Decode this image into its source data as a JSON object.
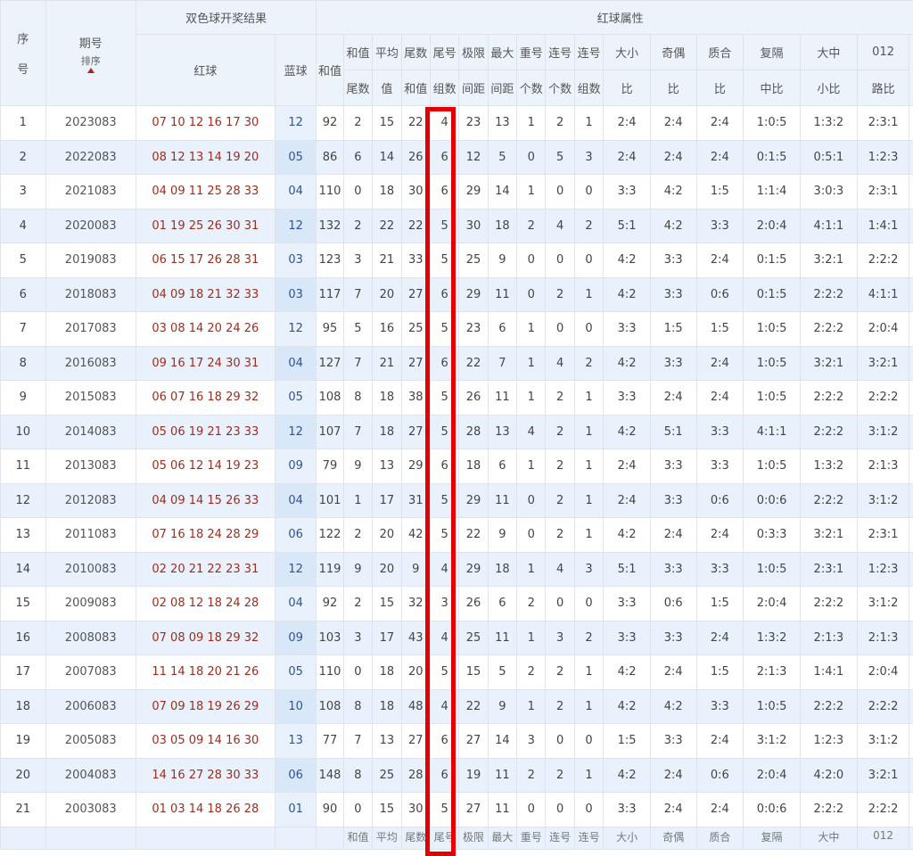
{
  "header": {
    "seq_top": "序",
    "seq_bottom": "号",
    "period": "期号",
    "sort_label": "排序",
    "draw_result": "双色球开奖结果",
    "red_attrs": "红球属性",
    "red_ball": "红球",
    "blue_ball": "蓝球",
    "sum": "和值",
    "cols": [
      {
        "top": "和值",
        "bottom": "尾数"
      },
      {
        "top": "平均",
        "bottom": "值"
      },
      {
        "top": "尾数",
        "bottom": "和值"
      },
      {
        "top": "尾号",
        "bottom": "组数"
      },
      {
        "top": "极限",
        "bottom": "间距"
      },
      {
        "top": "最大",
        "bottom": "间距"
      },
      {
        "top": "重号",
        "bottom": "个数"
      },
      {
        "top": "连号",
        "bottom": "个数"
      },
      {
        "top": "连号",
        "bottom": "组数"
      },
      {
        "top": "大小",
        "bottom": "比"
      },
      {
        "top": "奇偶",
        "bottom": "比"
      },
      {
        "top": "质合",
        "bottom": "比"
      },
      {
        "top": "复隔",
        "bottom": "中比"
      },
      {
        "top": "大中",
        "bottom": "小比"
      },
      {
        "top": "012",
        "bottom": "路比"
      }
    ]
  },
  "rows": [
    {
      "seq": "1",
      "period": "2023083",
      "red": "07 10 12 16 17 30",
      "blue": "12",
      "sum": "92",
      "vals": [
        "2",
        "15",
        "22",
        "4",
        "23",
        "13",
        "1",
        "2",
        "1",
        "2:4",
        "2:4",
        "2:4",
        "1:0:5",
        "1:3:2",
        "2:3:1"
      ]
    },
    {
      "seq": "2",
      "period": "2022083",
      "red": "08 12 13 14 19 20",
      "blue": "05",
      "sum": "86",
      "vals": [
        "6",
        "14",
        "26",
        "6",
        "12",
        "5",
        "0",
        "5",
        "3",
        "2:4",
        "2:4",
        "2:4",
        "0:1:5",
        "0:5:1",
        "1:2:3"
      ]
    },
    {
      "seq": "3",
      "period": "2021083",
      "red": "04 09 11 25 28 33",
      "blue": "04",
      "sum": "110",
      "vals": [
        "0",
        "18",
        "30",
        "6",
        "29",
        "14",
        "1",
        "0",
        "0",
        "3:3",
        "4:2",
        "1:5",
        "1:1:4",
        "3:0:3",
        "2:3:1"
      ]
    },
    {
      "seq": "4",
      "period": "2020083",
      "red": "01 19 25 26 30 31",
      "blue": "12",
      "sum": "132",
      "vals": [
        "2",
        "22",
        "22",
        "5",
        "30",
        "18",
        "2",
        "4",
        "2",
        "5:1",
        "4:2",
        "3:3",
        "2:0:4",
        "4:1:1",
        "1:4:1"
      ]
    },
    {
      "seq": "5",
      "period": "2019083",
      "red": "06 15 17 26 28 31",
      "blue": "03",
      "sum": "123",
      "vals": [
        "3",
        "21",
        "33",
        "5",
        "25",
        "9",
        "0",
        "0",
        "0",
        "4:2",
        "3:3",
        "2:4",
        "0:1:5",
        "3:2:1",
        "2:2:2"
      ]
    },
    {
      "seq": "6",
      "period": "2018083",
      "red": "04 09 18 21 32 33",
      "blue": "03",
      "sum": "117",
      "vals": [
        "7",
        "20",
        "27",
        "6",
        "29",
        "11",
        "0",
        "2",
        "1",
        "4:2",
        "3:3",
        "0:6",
        "0:1:5",
        "2:2:2",
        "4:1:1"
      ]
    },
    {
      "seq": "7",
      "period": "2017083",
      "red": "03 08 14 20 24 26",
      "blue": "12",
      "sum": "95",
      "vals": [
        "5",
        "16",
        "25",
        "5",
        "23",
        "6",
        "1",
        "0",
        "0",
        "3:3",
        "1:5",
        "1:5",
        "1:0:5",
        "2:2:2",
        "2:0:4"
      ]
    },
    {
      "seq": "8",
      "period": "2016083",
      "red": "09 16 17 24 30 31",
      "blue": "04",
      "sum": "127",
      "vals": [
        "7",
        "21",
        "27",
        "6",
        "22",
        "7",
        "1",
        "4",
        "2",
        "4:2",
        "3:3",
        "2:4",
        "1:0:5",
        "3:2:1",
        "3:2:1"
      ]
    },
    {
      "seq": "9",
      "period": "2015083",
      "red": "06 07 16 18 29 32",
      "blue": "05",
      "sum": "108",
      "vals": [
        "8",
        "18",
        "38",
        "5",
        "26",
        "11",
        "1",
        "2",
        "1",
        "3:3",
        "2:4",
        "2:4",
        "1:0:5",
        "2:2:2",
        "2:2:2"
      ]
    },
    {
      "seq": "10",
      "period": "2014083",
      "red": "05 06 19 21 23 33",
      "blue": "12",
      "sum": "107",
      "vals": [
        "7",
        "18",
        "27",
        "5",
        "28",
        "13",
        "4",
        "2",
        "1",
        "4:2",
        "5:1",
        "3:3",
        "4:1:1",
        "2:2:2",
        "3:1:2"
      ]
    },
    {
      "seq": "11",
      "period": "2013083",
      "red": "05 06 12 14 19 23",
      "blue": "09",
      "sum": "79",
      "vals": [
        "9",
        "13",
        "29",
        "6",
        "18",
        "6",
        "1",
        "2",
        "1",
        "2:4",
        "3:3",
        "3:3",
        "1:0:5",
        "1:3:2",
        "2:1:3"
      ]
    },
    {
      "seq": "12",
      "period": "2012083",
      "red": "04 09 14 15 26 33",
      "blue": "04",
      "sum": "101",
      "vals": [
        "1",
        "17",
        "31",
        "5",
        "29",
        "11",
        "0",
        "2",
        "1",
        "2:4",
        "3:3",
        "0:6",
        "0:0:6",
        "2:2:2",
        "3:1:2"
      ]
    },
    {
      "seq": "13",
      "period": "2011083",
      "red": "07 16 18 24 28 29",
      "blue": "06",
      "sum": "122",
      "vals": [
        "2",
        "20",
        "42",
        "5",
        "22",
        "9",
        "0",
        "2",
        "1",
        "4:2",
        "2:4",
        "2:4",
        "0:3:3",
        "3:2:1",
        "2:3:1"
      ]
    },
    {
      "seq": "14",
      "period": "2010083",
      "red": "02 20 21 22 23 31",
      "blue": "12",
      "sum": "119",
      "vals": [
        "9",
        "20",
        "9",
        "4",
        "29",
        "18",
        "1",
        "4",
        "3",
        "5:1",
        "3:3",
        "3:3",
        "1:0:5",
        "2:3:1",
        "1:2:3"
      ]
    },
    {
      "seq": "15",
      "period": "2009083",
      "red": "02 08 12 18 24 28",
      "blue": "04",
      "sum": "92",
      "vals": [
        "2",
        "15",
        "32",
        "3",
        "26",
        "6",
        "2",
        "0",
        "0",
        "3:3",
        "0:6",
        "1:5",
        "2:0:4",
        "2:2:2",
        "3:1:2"
      ]
    },
    {
      "seq": "16",
      "period": "2008083",
      "red": "07 08 09 18 29 32",
      "blue": "09",
      "sum": "103",
      "vals": [
        "3",
        "17",
        "43",
        "4",
        "25",
        "11",
        "1",
        "3",
        "2",
        "3:3",
        "3:3",
        "2:4",
        "1:3:2",
        "2:1:3",
        "2:1:3"
      ]
    },
    {
      "seq": "17",
      "period": "2007083",
      "red": "11 14 18 20 21 26",
      "blue": "05",
      "sum": "110",
      "vals": [
        "0",
        "18",
        "20",
        "5",
        "15",
        "5",
        "2",
        "2",
        "1",
        "4:2",
        "2:4",
        "1:5",
        "2:1:3",
        "1:4:1",
        "2:0:4"
      ]
    },
    {
      "seq": "18",
      "period": "2006083",
      "red": "07 09 18 19 26 29",
      "blue": "10",
      "sum": "108",
      "vals": [
        "8",
        "18",
        "48",
        "4",
        "22",
        "9",
        "1",
        "2",
        "1",
        "4:2",
        "4:2",
        "3:3",
        "1:0:5",
        "2:2:2",
        "2:2:2"
      ]
    },
    {
      "seq": "19",
      "period": "2005083",
      "red": "03 05 09 14 16 30",
      "blue": "13",
      "sum": "77",
      "vals": [
        "7",
        "13",
        "27",
        "6",
        "27",
        "14",
        "3",
        "0",
        "0",
        "1:5",
        "3:3",
        "2:4",
        "3:1:2",
        "1:2:3",
        "3:1:2"
      ]
    },
    {
      "seq": "20",
      "period": "2004083",
      "red": "14 16 27 28 30 33",
      "blue": "06",
      "sum": "148",
      "vals": [
        "8",
        "25",
        "28",
        "6",
        "19",
        "11",
        "2",
        "2",
        "1",
        "4:2",
        "2:4",
        "0:6",
        "2:0:4",
        "4:2:0",
        "3:2:1"
      ]
    },
    {
      "seq": "21",
      "period": "2003083",
      "red": "01 03 14 18 26 28",
      "blue": "01",
      "sum": "90",
      "vals": [
        "0",
        "15",
        "30",
        "5",
        "27",
        "11",
        "0",
        "0",
        "0",
        "3:3",
        "2:4",
        "2:4",
        "0:0:6",
        "2:2:2",
        "2:2:2"
      ]
    }
  ],
  "footer_partial": [
    "和值",
    "平均",
    "尾数",
    "尾号",
    "极限",
    "最大",
    "重号",
    "连号",
    "连号",
    "大小",
    "奇偶",
    "质合",
    "复隔",
    "大中",
    "012"
  ],
  "colors": {
    "red_ball": "#9c2d1d",
    "blue_ball": "#2a53a0",
    "highlight": "#e30000",
    "header_bg": "#edf3fb",
    "stripe": "#e9f2fc"
  },
  "icons": {
    "sort": "sort-up-arrow-icon"
  }
}
